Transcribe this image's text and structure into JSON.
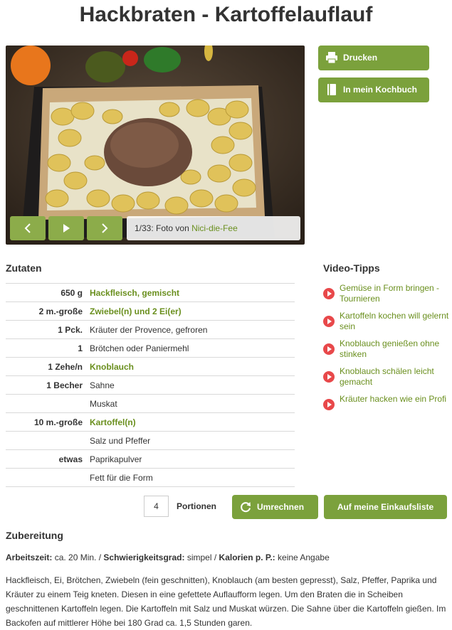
{
  "title": "Hackbraten - Kartoffelauflauf",
  "photo": {
    "counter": "1/33:",
    "by": "Foto von",
    "author": "Nici-die-Fee"
  },
  "actions": {
    "print": "Drucken",
    "cookbook": "In mein Kochbuch"
  },
  "ingredients": {
    "heading": "Zutaten",
    "rows": [
      {
        "amount": "650 g",
        "name": "Hackfleisch, gemischt"
      },
      {
        "amount": "2 m.-große",
        "name": "Zwiebel(n) und 2 Ei(er)"
      },
      {
        "amount": "1 Pck.",
        "name": "Kräuter der Provence, gefroren"
      },
      {
        "amount": "1",
        "name": "Brötchen oder Paniermehl"
      },
      {
        "amount": "1 Zehe/n",
        "name": "Knoblauch"
      },
      {
        "amount": "1 Becher",
        "name": "Sahne"
      },
      {
        "amount": "",
        "name": "Muskat"
      },
      {
        "amount": "10 m.-große",
        "name": "Kartoffel(n)"
      },
      {
        "amount": "",
        "name": "Salz und Pfeffer"
      },
      {
        "amount": "etwas",
        "name": "Paprikapulver"
      },
      {
        "amount": "",
        "name": "Fett für die Form"
      }
    ]
  },
  "video_tips": {
    "heading": "Video-Tipps",
    "items": [
      "Gemüse in Form bringen - Tournieren",
      "Kartoffeln kochen will gelernt sein",
      "Knoblauch genießen ohne stinken",
      "Knoblauch schälen leicht gemacht",
      "Kräuter hacken wie ein Profi"
    ]
  },
  "portions": {
    "value": "4",
    "label": "Portionen",
    "recalc": "Umrechnen",
    "shopping": "Auf meine Einkaufsliste"
  },
  "preparation": {
    "heading": "Zubereitung",
    "worktime_label": "Arbeitszeit:",
    "worktime": "ca. 20 Min.",
    "difficulty_label": "Schwierigkeitsgrad:",
    "difficulty": "simpel",
    "calories_label": "Kalorien p. P.:",
    "calories": "keine Angabe",
    "text": "Hackfleisch, Ei, Brötchen, Zwiebeln (fein geschnitten), Knoblauch (am besten gepresst), Salz, Pfeffer, Paprika und Kräuter zu einem Teig kneten. Diesen in eine gefettete Auflaufform legen. Um den Braten die in Scheiben geschnittenen Kartoffeln legen. Die Kartoffeln mit Salz und Muskat würzen. Die Sahne über die Kartoffeln gießen. Im Backofen auf mittlerer Höhe bei 180 Grad ca. 1,5 Stunden garen."
  }
}
